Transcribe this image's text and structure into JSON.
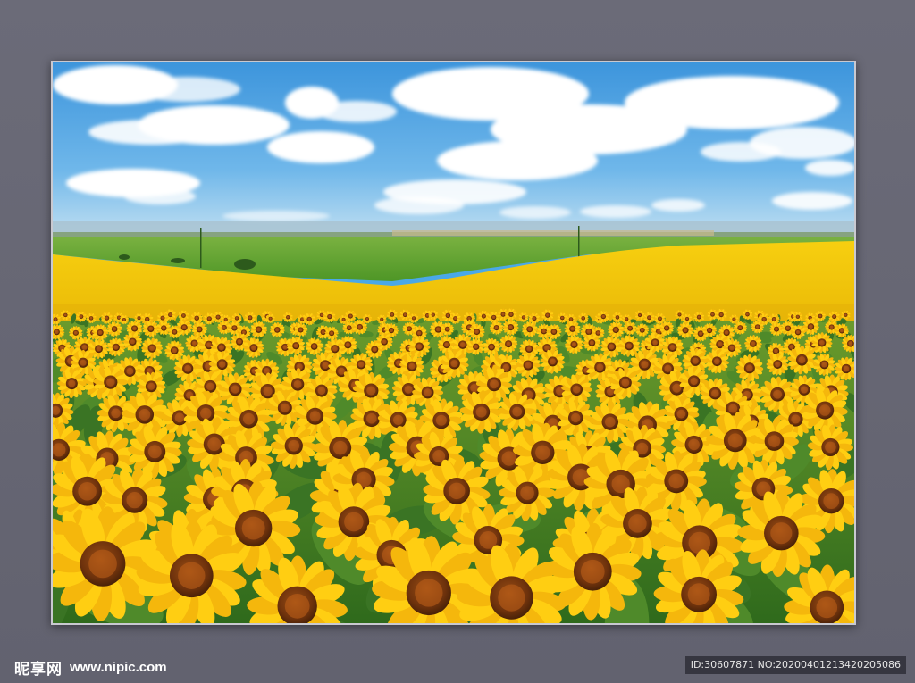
{
  "watermark": {
    "logo_text": "昵享网",
    "site_url": "www.nipic.com",
    "id_text": "ID:30607871 NO:20200401213420205086"
  },
  "scene": {
    "subject": "sunflower field under blue sky with clouds",
    "colors": {
      "sky_top": "#3d9ae0",
      "sky_bottom": "#b8dcf2",
      "green_field": "#5aa02a",
      "yellow_field": "#f2c40a",
      "petal": "#ffce12",
      "center": "#7a3a0c"
    }
  }
}
